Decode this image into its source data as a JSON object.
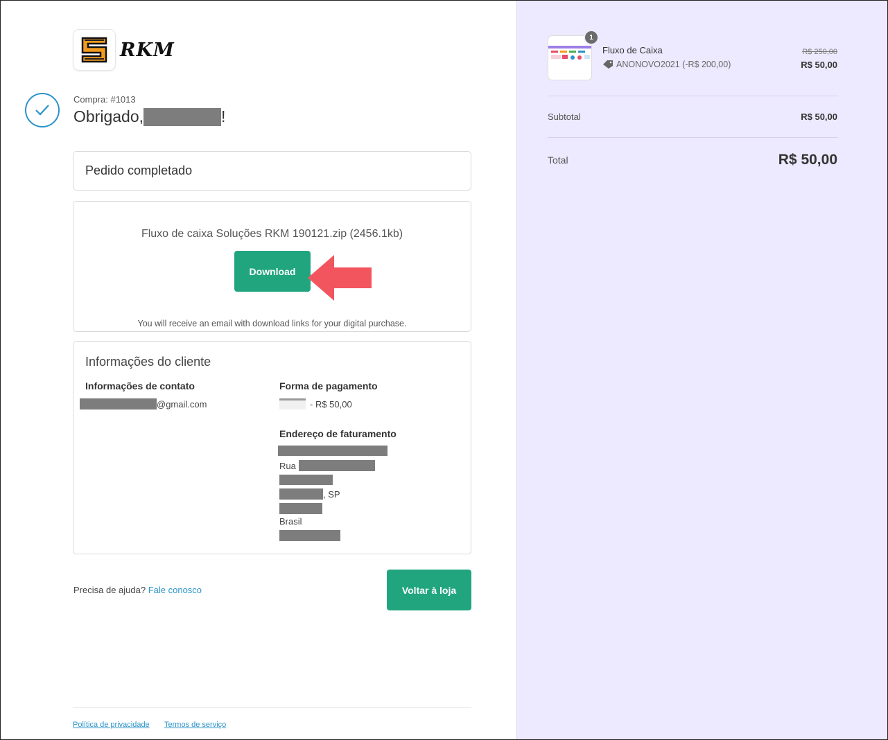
{
  "logo": {
    "text": "RKM"
  },
  "order": {
    "number_label": "Compra: #1013",
    "thanks_prefix": "Obrigado,",
    "thanks_suffix": "!"
  },
  "status": {
    "text": "Pedido completado"
  },
  "download": {
    "file_label": "Fluxo de caixa Soluções RKM 190121.zip (2456.1kb)",
    "button_label": "Download",
    "note": "You will receive an email with download links for your digital purchase."
  },
  "client": {
    "title": "Informações do cliente",
    "contact_heading": "Informações de contato",
    "email_suffix": "@gmail.com",
    "payment_heading": "Forma de pagamento",
    "payment_amount": "- R$ 50,00",
    "billing_heading": "Endereço de faturamento",
    "street_prefix": "Rua",
    "state_suffix": ", SP",
    "country": "Brasil"
  },
  "help": {
    "text": "Precisa de ajuda?",
    "link": "Fale conosco"
  },
  "back_button": "Voltar à loja",
  "footer": {
    "privacy": "Política de privacidade",
    "terms": "Termos de serviço"
  },
  "cart": {
    "quantity": "1",
    "product_name": "Fluxo de Caixa",
    "discount_label": "ANONOVO2021 (-R$ 200,00)",
    "old_price": "R$ 250,00",
    "price": "R$ 50,00",
    "subtotal_label": "Subtotal",
    "subtotal_value": "R$ 50,00",
    "total_label": "Total",
    "total_value": "R$ 50,00"
  },
  "colors": {
    "accent_green": "#21a57f",
    "link_blue": "#2a93c9",
    "sidebar_bg": "#ede9fe",
    "annotation_arrow": "#f2555e",
    "logo_orange": "#f39a1e"
  }
}
